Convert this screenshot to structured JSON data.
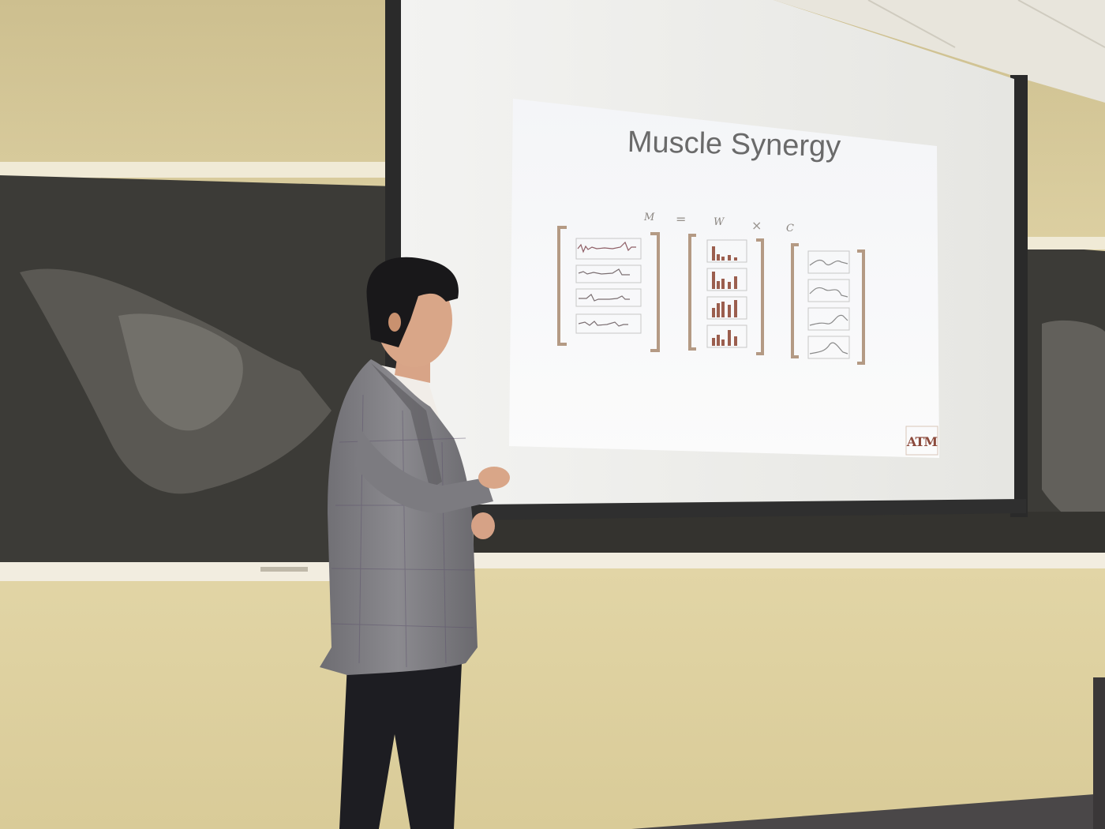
{
  "slide": {
    "title": "Muscle Synergy",
    "equation": {
      "m_label": "M",
      "equals": "=",
      "w_label": "W",
      "times": "×",
      "c_label": "C"
    },
    "logo_text": "ATM"
  },
  "colors": {
    "wall": "#e3d6a8",
    "chalkboard": "#3b3a36",
    "screen": "#f2f2f0",
    "slide_bg": "#f7f7f7",
    "bracket": "#b49a84",
    "bar_color": "#9b5e4e",
    "logo_color": "#8c4a3c"
  }
}
